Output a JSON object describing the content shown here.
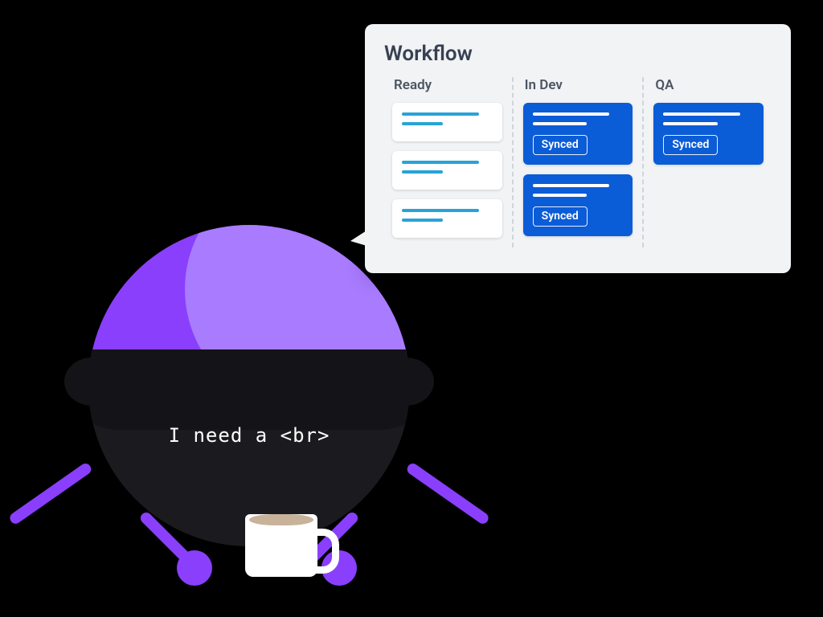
{
  "robot": {
    "shirt_text": "I need a <br>"
  },
  "workflow": {
    "title": "Workflow",
    "columns": [
      {
        "title": "Ready",
        "cards": [
          {
            "style": "white"
          },
          {
            "style": "white"
          },
          {
            "style": "white"
          }
        ]
      },
      {
        "title": "In Dev",
        "cards": [
          {
            "style": "blue",
            "badge": "Synced"
          },
          {
            "style": "blue",
            "badge": "Synced"
          }
        ]
      },
      {
        "title": "QA",
        "cards": [
          {
            "style": "blue",
            "badge": "Synced"
          }
        ]
      }
    ]
  },
  "colors": {
    "accent_purple": "#8a3ffc",
    "card_bg": "#f1f3f5",
    "ticket_blue": "#0b5cd7",
    "ticket_line_cyan": "#29a3d7"
  }
}
